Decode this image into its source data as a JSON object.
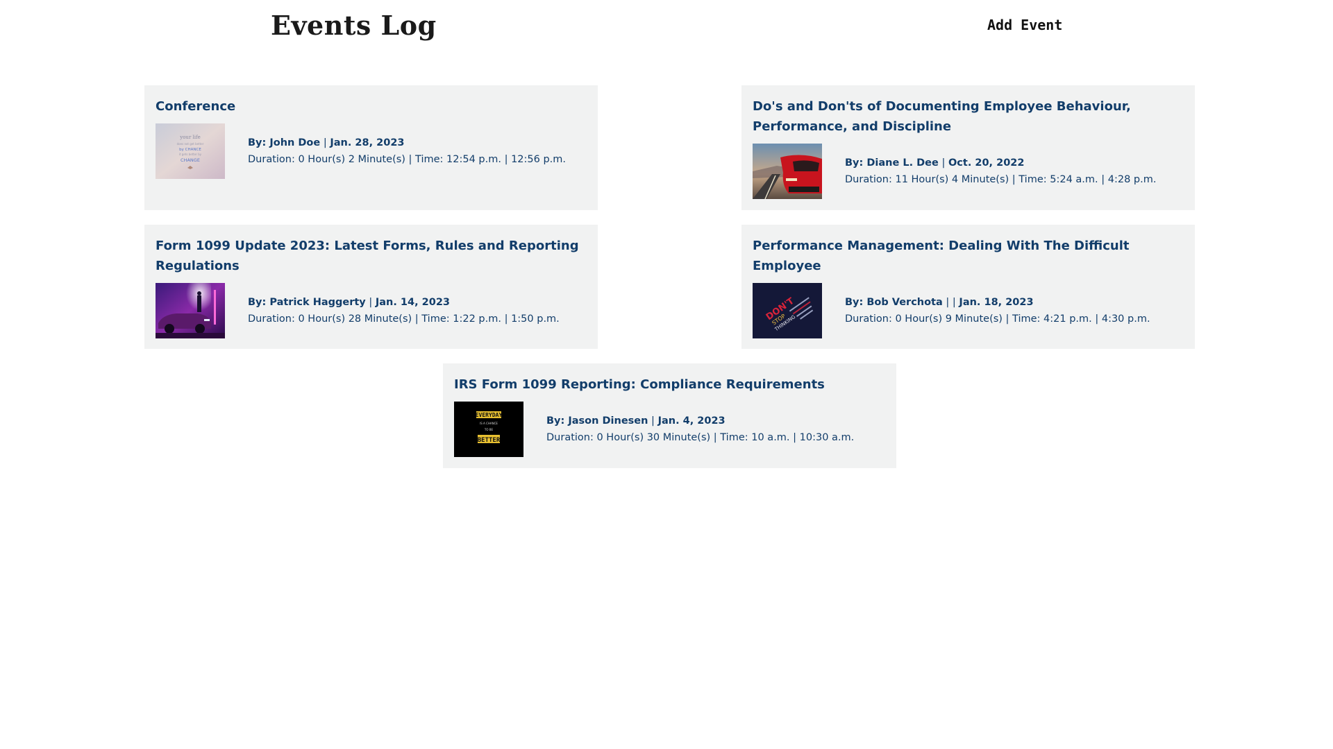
{
  "header": {
    "title": "Events Log",
    "add_event_label": "Add Event"
  },
  "events": [
    {
      "title": "Conference",
      "author": "By: John Doe",
      "separator": " | ",
      "date": "Jan. 28, 2023",
      "details": "Duration: 0 Hour(s) 2 Minute(s) | Time: 12:54 p.m. | 12:56 p.m.",
      "thumbnail": "your-life-change-image",
      "thumbnail_text": [
        "your life",
        "does not get better",
        "by CHANCE",
        "it gets better by",
        "CHANGE"
      ]
    },
    {
      "title": "Do's and Don'ts of Documenting Employee Behaviour, Performance, and Discipline",
      "author": "By: Diane L. Dee",
      "separator": " | ",
      "date": "Oct. 20, 2022",
      "details": "Duration: 11 Hour(s) 4 Minute(s) | Time: 5:24 a.m. | 4:28 p.m.",
      "thumbnail": "red-car-road-image"
    },
    {
      "title": "Form 1099 Update 2023: Latest Forms, Rules and Reporting Regulations",
      "author": "By: Patrick Haggerty",
      "separator": " | ",
      "date": "Jan. 14, 2023",
      "details": "Duration: 0 Hour(s) 28 Minute(s) | Time: 1:22 p.m. | 1:50 p.m.",
      "thumbnail": "purple-car-neon-image"
    },
    {
      "title": "Performance Management: Dealing With The Difficult Employee",
      "author": "By: Bob Verchota",
      "separator": " | | ",
      "date": "Jan. 18, 2023",
      "details": "Duration: 0 Hour(s) 9 Minute(s) | Time: 4:21 p.m. | 4:30 p.m.",
      "thumbnail": "dont-stop-typography-image",
      "thumbnail_text": [
        "DON'T",
        "STOP",
        "THINKING"
      ]
    },
    {
      "title": "IRS Form 1099 Reporting: Compliance Requirements",
      "author": "By: Jason Dinesen",
      "separator": " | ",
      "date": "Jan. 4, 2023",
      "details": "Duration: 0 Hour(s) 30 Minute(s) | Time: 10 a.m. | 10:30 a.m.",
      "thumbnail": "everyday-better-image",
      "thumbnail_text": [
        "EVERYDAY",
        "IS A CHANCE",
        "TO BE",
        "BETTER"
      ]
    }
  ],
  "colors": {
    "card_background": "#f1f2f2",
    "title_text": "#123d6a",
    "heading_text": "#1a1a1a"
  }
}
